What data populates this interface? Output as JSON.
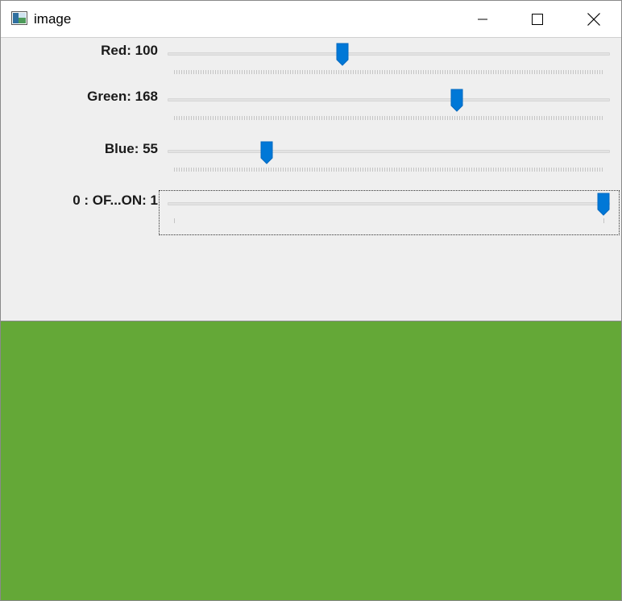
{
  "window": {
    "title": "image",
    "icon": "image-window-icon",
    "controls": [
      "minimize-icon",
      "maximize-icon",
      "close-icon"
    ]
  },
  "trackbars": [
    {
      "label": "Red: 100",
      "value": 100,
      "max": 255
    },
    {
      "label": "Green: 168",
      "value": 168,
      "max": 255
    },
    {
      "label": "Blue: 55",
      "value": 55,
      "max": 255
    },
    {
      "label": "0 : OF...ON: 1",
      "value": 1,
      "max": 1
    }
  ],
  "image": {
    "color": "#64a837"
  },
  "colors": {
    "accent": "#0078d7",
    "panel": "#efefef"
  }
}
